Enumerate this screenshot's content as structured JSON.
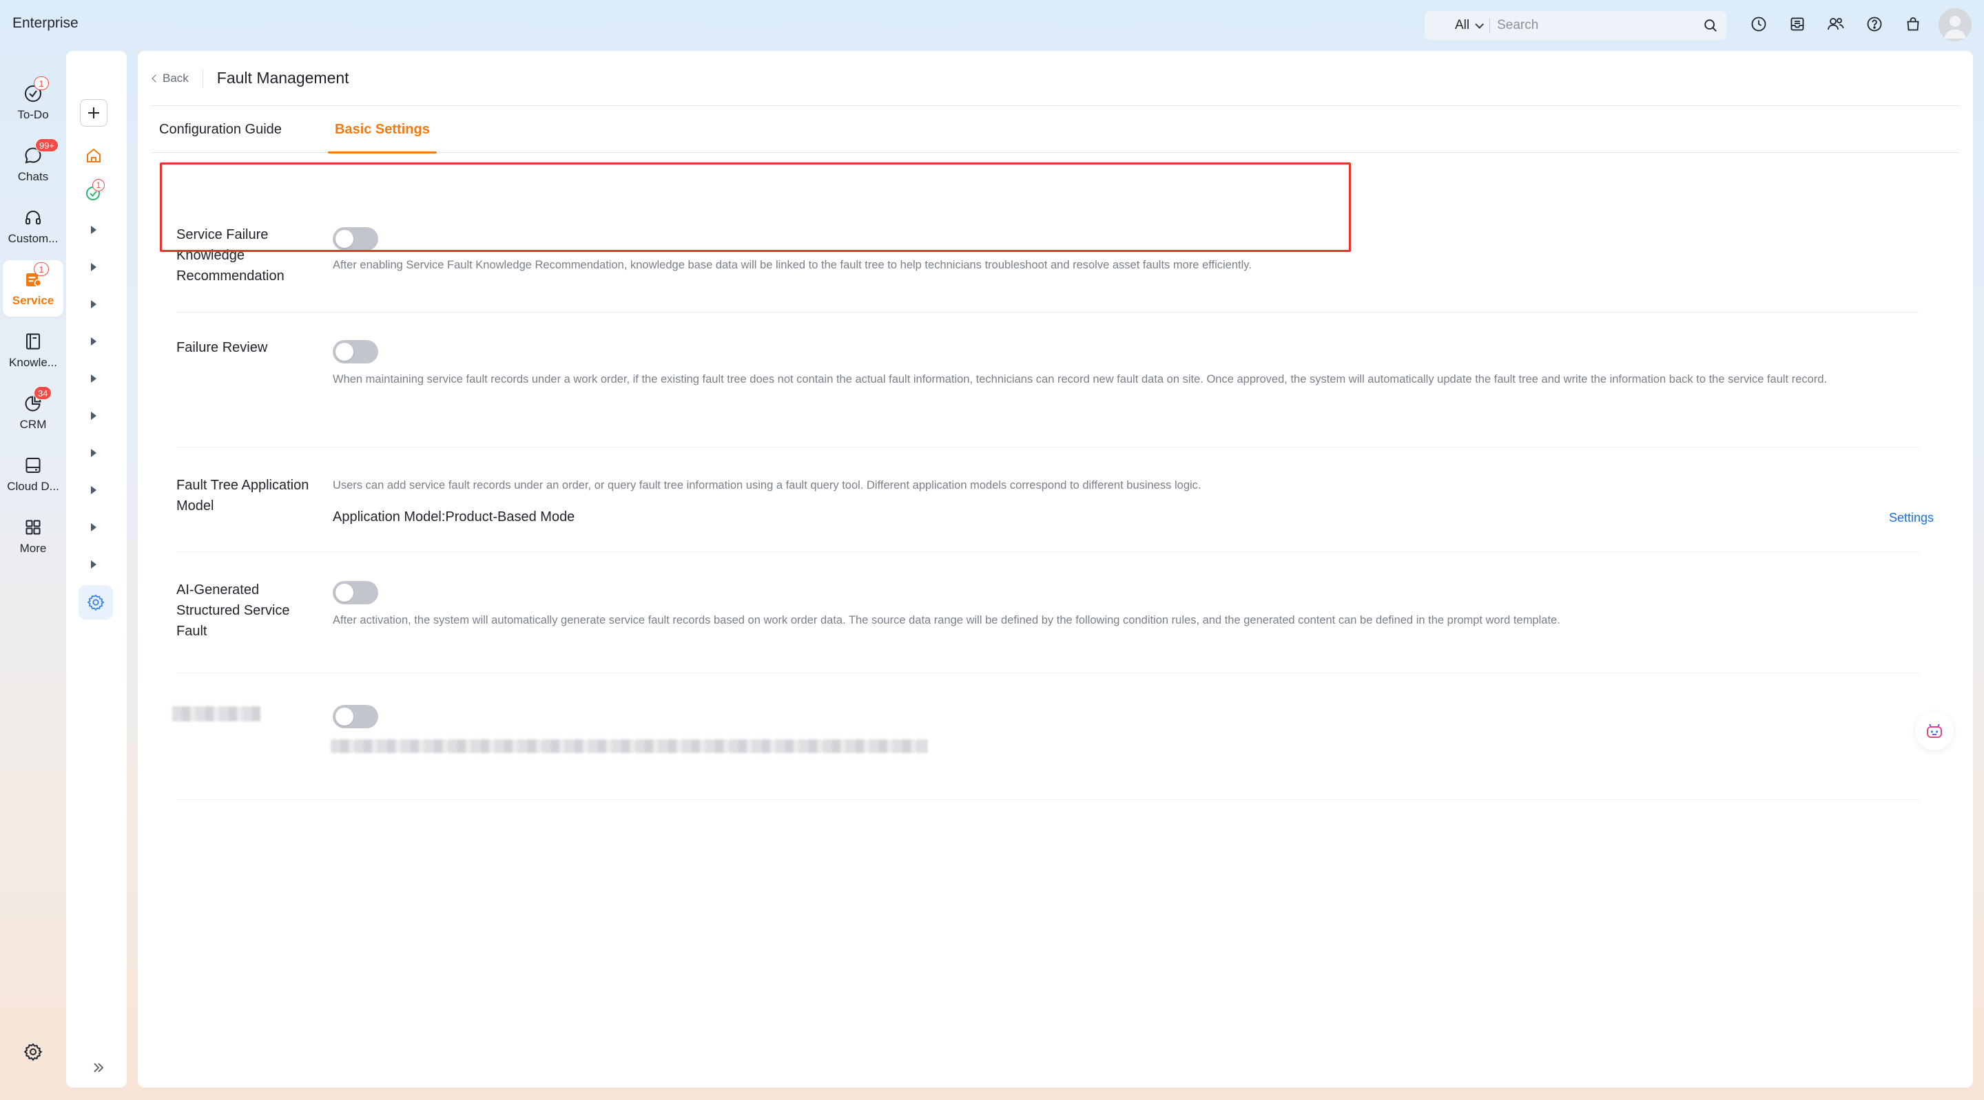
{
  "app": {
    "brand": "Enterprise"
  },
  "search": {
    "scope": "All",
    "placeholder": "Search"
  },
  "top_icons": [
    "clock-icon",
    "inbox-icon",
    "contacts-icon",
    "help-icon",
    "bag-icon"
  ],
  "rail": {
    "items": [
      {
        "label": "To-Do",
        "icon": "todo-icon",
        "badge": "1"
      },
      {
        "label": "Chats",
        "icon": "chat-icon",
        "badge": "99+"
      },
      {
        "label": "Custom...",
        "icon": "headset-icon",
        "badge": ""
      },
      {
        "label": "Service",
        "icon": "service-icon",
        "badge": "1"
      },
      {
        "label": "Knowle...",
        "icon": "book-icon",
        "badge": ""
      },
      {
        "label": "CRM",
        "icon": "crm-icon",
        "badge": "34"
      },
      {
        "label": "Cloud D...",
        "icon": "drive-icon",
        "badge": ""
      },
      {
        "label": "More",
        "icon": "grid-icon",
        "badge": ""
      }
    ]
  },
  "subbar": {
    "todo_badge": "1"
  },
  "header": {
    "back_label": "Back",
    "title": "Fault Management"
  },
  "tabs": [
    {
      "label": "Configuration Guide",
      "active": false
    },
    {
      "label": "Basic Settings",
      "active": true
    }
  ],
  "settings": {
    "knowledge_recommendation": {
      "label": "Service Failure Knowledge Recommendation",
      "enabled": false,
      "description": "After enabling Service Fault Knowledge Recommendation, knowledge base data will be linked to the fault tree to help technicians troubleshoot and resolve asset faults more efficiently."
    },
    "failure_review": {
      "label": "Failure Review",
      "enabled": false,
      "description": "When maintaining service fault records under a work order, if the existing fault tree does not contain the actual fault information, technicians can record new fault data on site. Once approved, the system will automatically update the fault tree and write the information back to the service fault record."
    },
    "application_model": {
      "label": "Fault Tree Application Model",
      "description": "Users can add service fault records under an order, or query fault tree information using a fault query tool. Different application models correspond to different business logic.",
      "model_line": "Application Model:Product-Based Mode",
      "settings_link": "Settings"
    },
    "ai_generated": {
      "label": "AI-Generated Structured Service Fault",
      "enabled": false,
      "description": "After activation, the system will automatically generate service fault records based on work order data. The source data range will be defined by the following condition rules, and the generated content can be defined in the prompt word template."
    },
    "redacted": {
      "enabled": false
    }
  },
  "colors": {
    "accent": "#f07a12",
    "link": "#1e6fd9",
    "highlight": "#e8342e",
    "badge": "#f54a45"
  }
}
